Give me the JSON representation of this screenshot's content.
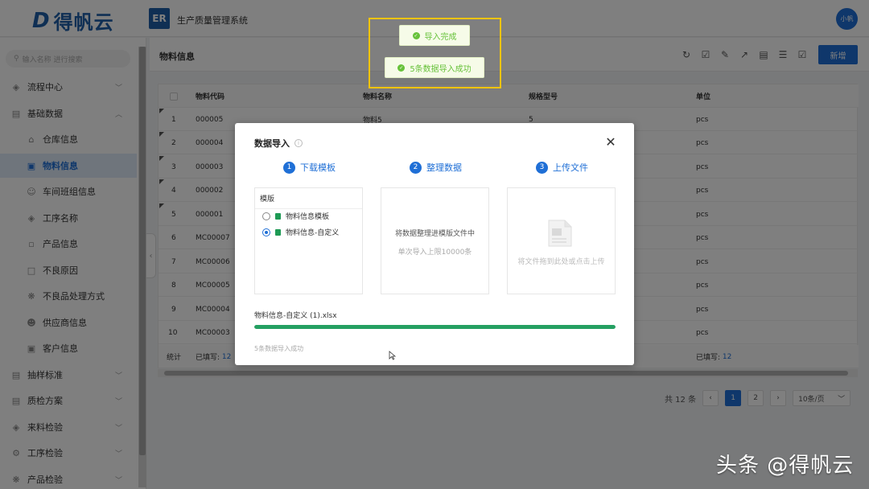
{
  "app": {
    "logo_text": "得帆云",
    "logo_mark": "D",
    "system_icon_text": "ER",
    "system_title": "生产质量管理系统",
    "avatar_text": "小帆"
  },
  "sidebar": {
    "search_placeholder": "输入名称 进行搜索",
    "items": [
      {
        "label": "流程中心",
        "icon": "layers-icon",
        "chev": "﹀"
      },
      {
        "label": "基础数据",
        "icon": "database-icon",
        "chev": "︿"
      },
      {
        "label": "仓库信息",
        "icon": "home-icon"
      },
      {
        "label": "物料信息",
        "icon": "box-icon"
      },
      {
        "label": "车间班组信息",
        "icon": "user-group-icon"
      },
      {
        "label": "工序名称",
        "icon": "layers-icon"
      },
      {
        "label": "产品信息",
        "icon": "product-icon"
      },
      {
        "label": "不良原因",
        "icon": "doc-icon"
      },
      {
        "label": "不良品处理方式",
        "icon": "cube-icon"
      },
      {
        "label": "供应商信息",
        "icon": "user-icon"
      },
      {
        "label": "客户信息",
        "icon": "card-icon"
      },
      {
        "label": "抽样标准",
        "icon": "sample-icon",
        "chev": "﹀"
      },
      {
        "label": "质检方案",
        "icon": "plan-icon",
        "chev": "﹀"
      },
      {
        "label": "来料检验",
        "icon": "layers-icon",
        "chev": "﹀"
      },
      {
        "label": "工序检验",
        "icon": "process-icon",
        "chev": "﹀"
      },
      {
        "label": "产品检验",
        "icon": "cube-icon",
        "chev": "﹀"
      }
    ]
  },
  "page": {
    "title": "物料信息",
    "add_label": "新增"
  },
  "table": {
    "headers": [
      "",
      "物料代码",
      "物料名称",
      "规格型号",
      "单位"
    ],
    "rows": [
      {
        "idx": "1",
        "code": "000005",
        "name": "物料5",
        "spec": "5",
        "unit": "pcs"
      },
      {
        "idx": "2",
        "code": "000004",
        "name": "",
        "spec": "",
        "unit": "pcs"
      },
      {
        "idx": "3",
        "code": "000003",
        "name": "",
        "spec": "",
        "unit": "pcs"
      },
      {
        "idx": "4",
        "code": "000002",
        "name": "",
        "spec": "",
        "unit": "pcs"
      },
      {
        "idx": "5",
        "code": "000001",
        "name": "",
        "spec": "",
        "unit": "pcs"
      },
      {
        "idx": "6",
        "code": "MC00007",
        "name": "",
        "spec": "",
        "unit": "pcs"
      },
      {
        "idx": "7",
        "code": "MC00006",
        "name": "",
        "spec": "",
        "unit": "pcs"
      },
      {
        "idx": "8",
        "code": "MC00005",
        "name": "",
        "spec": "",
        "unit": "pcs"
      },
      {
        "idx": "9",
        "code": "MC00004",
        "name": "",
        "spec": "",
        "unit": "pcs"
      },
      {
        "idx": "10",
        "code": "MC00003",
        "name": "",
        "spec": "",
        "unit": "pcs"
      }
    ],
    "total_label": "统计",
    "filled_label": "已填写:",
    "filled_count": "12"
  },
  "pager": {
    "total": "共 12 条",
    "prev": "‹",
    "page1": "1",
    "page2": "2",
    "next": "›",
    "size": "10条/页",
    "size_chev": "﹀"
  },
  "modal": {
    "title": "数据导入",
    "steps": [
      {
        "num": "1",
        "label": "下载模板"
      },
      {
        "num": "2",
        "label": "整理数据"
      },
      {
        "num": "3",
        "label": "上传文件"
      }
    ],
    "template_header": "模版",
    "template_options": [
      "物料信息模板",
      "物料信息-自定义"
    ],
    "organize_text": "将数据整理进模版文件中",
    "organize_sub": "单次导入上限10000条",
    "upload_text": "将文件拖到此处或点击上传",
    "file_name": "物料信息-自定义 (1).xlsx",
    "progress": 1.0,
    "result": "5条数据导入成功"
  },
  "toasts": [
    "导入完成",
    "5条数据导入成功"
  ],
  "watermark": "头条 @得帆云",
  "colors": {
    "primary": "#1f6fd6",
    "success": "#67c23a",
    "progress": "#24a062",
    "highlight": "#f5c400"
  }
}
